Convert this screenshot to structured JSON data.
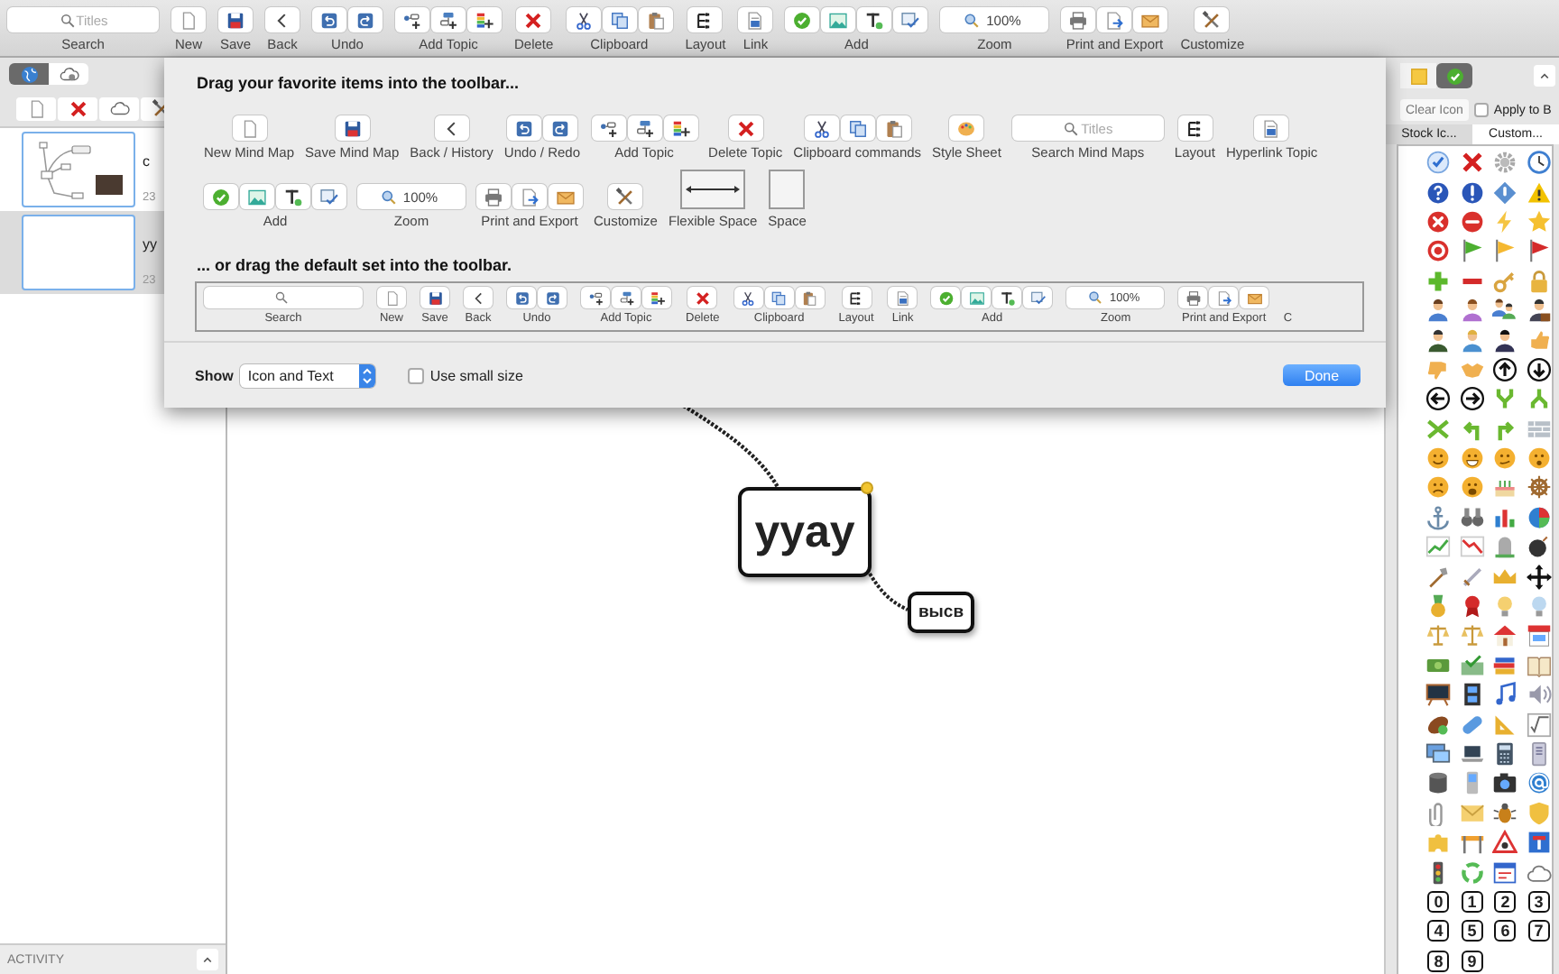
{
  "toolbar": {
    "groups": [
      {
        "kind": "search",
        "placeholder": "Titles",
        "label": "Search"
      },
      {
        "kind": "new",
        "label": "New"
      },
      {
        "kind": "save",
        "label": "Save"
      },
      {
        "kind": "back",
        "label": "Back"
      },
      {
        "kind": "undo",
        "label": "Undo"
      },
      {
        "kind": "addtopic",
        "label": "Add Topic"
      },
      {
        "kind": "delete",
        "label": "Delete"
      },
      {
        "kind": "clipboard",
        "label": "Clipboard"
      },
      {
        "kind": "layout",
        "label": "Layout"
      },
      {
        "kind": "link",
        "label": "Link"
      },
      {
        "kind": "add",
        "label": "Add"
      },
      {
        "kind": "zoom",
        "value": "100%",
        "label": "Zoom"
      },
      {
        "kind": "print",
        "label": "Print and Export"
      },
      {
        "kind": "customize",
        "label": "Customize"
      }
    ]
  },
  "sidebar": {
    "view_tabs": [
      {
        "kind": "globe",
        "selected": true
      },
      {
        "kind": "cloudgear",
        "selected": false
      }
    ],
    "maps": [
      {
        "title": "c",
        "date": "23",
        "kind": "diagram",
        "selected": false
      },
      {
        "title": "yy",
        "date": "23",
        "kind": "blank",
        "selected": true
      }
    ],
    "activity": "ACTIVITY"
  },
  "canvas": {
    "nodes": [
      {
        "text": "yyay",
        "kind": "main",
        "selected": true
      },
      {
        "text": "высв",
        "kind": "sub",
        "selected": false
      }
    ]
  },
  "sheet": {
    "favorites_title": "Drag your favorite items into the toolbar...",
    "favorite_rows": [
      {
        "items": [
          {
            "kind": "new",
            "label": "New Mind Map"
          },
          {
            "kind": "save",
            "label": "Save Mind Map"
          },
          {
            "kind": "back",
            "label": "Back / History"
          },
          {
            "kind": "undo",
            "label": "Undo / Redo"
          },
          {
            "kind": "addtopic",
            "label": "Add Topic"
          },
          {
            "kind": "delete",
            "label": "Delete Topic"
          },
          {
            "kind": "clipboard",
            "label": "Clipboard commands"
          },
          {
            "kind": "style",
            "label": "Style Sheet"
          },
          {
            "kind": "search",
            "placeholder": "Titles",
            "label": "Search Mind Maps"
          },
          {
            "kind": "layout",
            "label": "Layout"
          },
          {
            "kind": "link",
            "label": "Hyperlink Topic"
          }
        ]
      },
      {
        "items": [
          {
            "kind": "add",
            "label": "Add"
          },
          {
            "kind": "zoom",
            "value": "100%",
            "label": "Zoom"
          },
          {
            "kind": "print",
            "label": "Print and Export"
          },
          {
            "kind": "customize",
            "label": "Customize"
          },
          {
            "kind": "flex",
            "label": "Flexible Space"
          },
          {
            "kind": "space",
            "label": "Space"
          }
        ]
      }
    ],
    "default_title": "... or drag the default set into the toolbar.",
    "default_set": [
      {
        "kind": "search",
        "label": "Search"
      },
      {
        "kind": "new",
        "label": "New"
      },
      {
        "kind": "save",
        "label": "Save"
      },
      {
        "kind": "back",
        "label": "Back"
      },
      {
        "kind": "undo",
        "label": "Undo"
      },
      {
        "kind": "addtopic",
        "label": "Add Topic"
      },
      {
        "kind": "delete",
        "label": "Delete"
      },
      {
        "kind": "clipboard",
        "label": "Clipboard"
      },
      {
        "kind": "layout",
        "label": "Layout"
      },
      {
        "kind": "link",
        "label": "Link"
      },
      {
        "kind": "add",
        "label": "Add"
      },
      {
        "kind": "zoom",
        "value": "100%",
        "label": "Zoom"
      },
      {
        "kind": "print",
        "label": "Print and Export"
      },
      {
        "kind": "partial",
        "label": "C"
      }
    ],
    "show_label": "Show",
    "show_value": "Icon and Text",
    "small_size": {
      "label": "Use small size",
      "checked": false
    },
    "done": "Done"
  },
  "icon_panel": {
    "tabs": [
      {
        "kind": "notes",
        "selected": false
      },
      {
        "kind": "check",
        "selected": true
      }
    ],
    "clear_button": "Clear Icon",
    "apply": {
      "label": "Apply to B",
      "checked": false
    },
    "icon_tabs": [
      {
        "label": "Stock Ic...",
        "selected": true
      },
      {
        "label": "Custom...",
        "selected": false
      }
    ],
    "digits": [
      "0",
      "1",
      "2",
      "3",
      "4",
      "5",
      "6",
      "7",
      "8",
      "9"
    ]
  }
}
